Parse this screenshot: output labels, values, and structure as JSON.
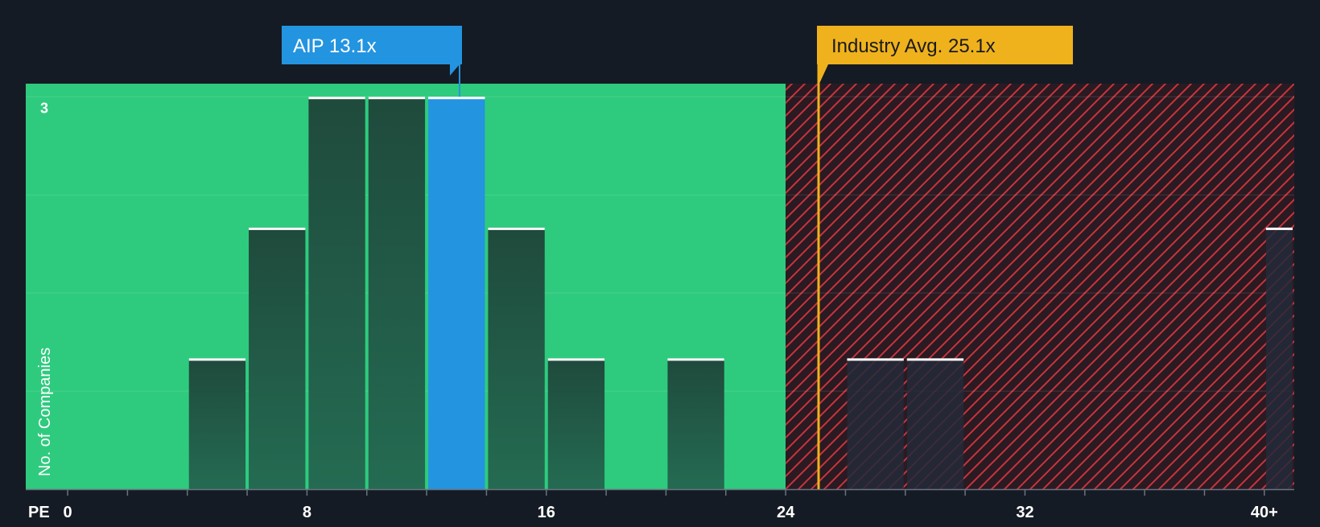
{
  "chart_data": {
    "type": "bar",
    "xlabel": "PE",
    "ylabel": "No. of Companies",
    "x_ticks": [
      {
        "value": 0,
        "label": "0"
      },
      {
        "value": 8,
        "label": "8"
      },
      {
        "value": 16,
        "label": "16"
      },
      {
        "value": 24,
        "label": "24"
      },
      {
        "value": 32,
        "label": "32"
      },
      {
        "value": 40,
        "label": "40+"
      }
    ],
    "y_ticks": [
      {
        "value": 3,
        "label": "3"
      }
    ],
    "xlim": [
      -1.4,
      41
    ],
    "ylim": [
      0,
      3.1
    ],
    "grid": true,
    "bars": [
      {
        "x0": 4,
        "x1": 6,
        "value": 1
      },
      {
        "x0": 6,
        "x1": 8,
        "value": 2
      },
      {
        "x0": 8,
        "x1": 10,
        "value": 3
      },
      {
        "x0": 10,
        "x1": 12,
        "value": 3
      },
      {
        "x0": 12,
        "x1": 14,
        "value": 3,
        "highlight": true
      },
      {
        "x0": 14,
        "x1": 16,
        "value": 2
      },
      {
        "x0": 16,
        "x1": 18,
        "value": 1
      },
      {
        "x0": 20,
        "x1": 22,
        "value": 1
      },
      {
        "x0": 26,
        "x1": 28,
        "value": 1
      },
      {
        "x0": 28,
        "x1": 30,
        "value": 1
      },
      {
        "x0": 40,
        "x1": 41,
        "value": 2
      }
    ],
    "fair_zone_end": 24,
    "company": {
      "label": "AIP 13.1x",
      "value": 13.1
    },
    "industry": {
      "label": "Industry Avg. 25.1x",
      "value": 25.1
    },
    "colors": {
      "background": "#151b24",
      "fair_zone": "#2ecb7e",
      "expensive_zone": "#2a1a22",
      "hatch": "#c9333e",
      "bar_dark": "#1f4a3c",
      "highlight": "#2394e0",
      "industry": "#efb21d",
      "text": "#ffffff",
      "industry_text": "#1a1a1a"
    }
  }
}
